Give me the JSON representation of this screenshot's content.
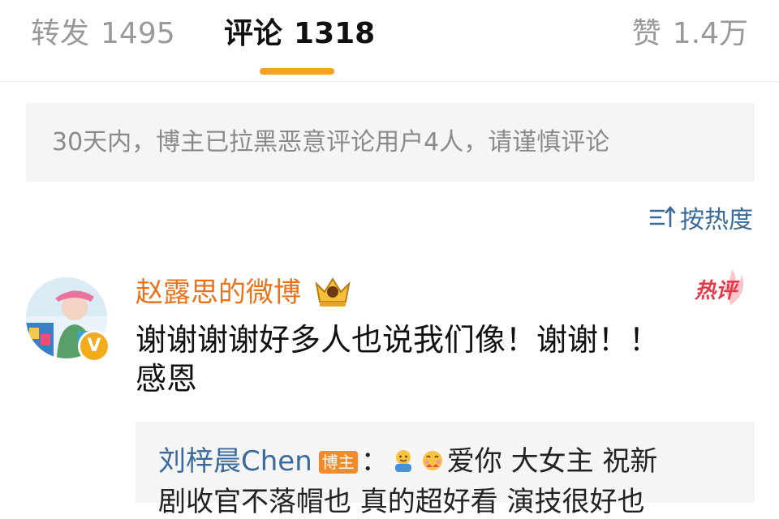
{
  "tabs": {
    "repost": {
      "label": "转发",
      "count": "1495"
    },
    "comments": {
      "label": "评论",
      "count": "1318"
    },
    "likes": {
      "label": "赞",
      "count": "1.4万"
    }
  },
  "notice": {
    "text": "30天内，博主已拉黑恶意评论用户4人，请谨慎评论"
  },
  "sort": {
    "label": "按热度"
  },
  "comment": {
    "username": "赵露思的微博",
    "hot_badge": "热评",
    "text_line1": "谢谢谢谢好多人也说我们像！谢谢！！",
    "text_line2": "感恩",
    "verified_symbol": "V",
    "reply": {
      "name": "刘梓晨Chen",
      "tag": "博主",
      "separator": "：",
      "text": "爱你 大女主 祝新",
      "text_line2": "剧收官不落帽也 真的超好看 演技很好也"
    }
  },
  "colors": {
    "accent": "#f7a21e",
    "link": "#3a6a9b",
    "username": "#e8731a",
    "hot": "#e8394a"
  }
}
